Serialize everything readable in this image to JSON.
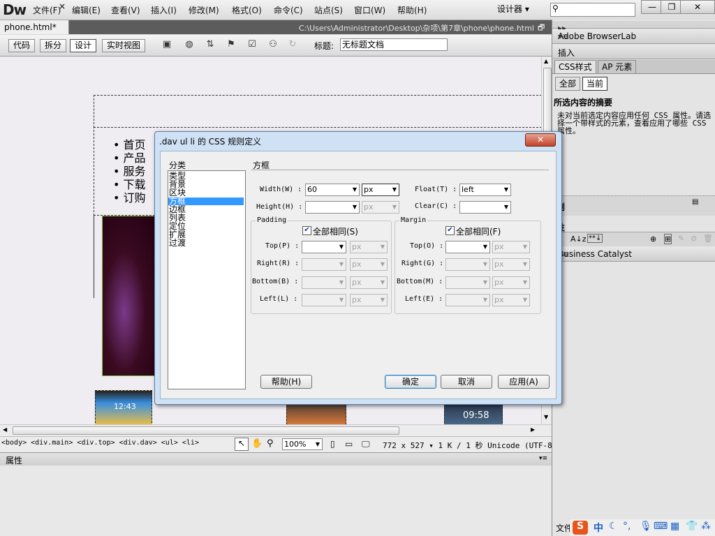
{
  "app": {
    "logo": "Dw",
    "menus": [
      "文件(F)",
      "编辑(E)",
      "查看(V)",
      "插入(I)",
      "修改(M)",
      "格式(O)",
      "命令(C)",
      "站点(S)",
      "窗口(W)",
      "帮助(H)"
    ],
    "workspace": "设计器 ▾",
    "window_buttons": [
      "—",
      "❐",
      "✕"
    ]
  },
  "document": {
    "tab": "phone.html*",
    "tab_close": "×",
    "path": "C:\\Users\\Administrator\\Desktop\\杂项\\第7章\\phone\\phone.html",
    "views": [
      "代码",
      "拆分",
      "设计",
      "实时视图"
    ],
    "active_view": "设计",
    "title_label": "标题:",
    "title_value": "无标题文档"
  },
  "design": {
    "nav_items": [
      "首页",
      "产品",
      "服务",
      "下载",
      "订购"
    ],
    "thumb_time_1": "12:43",
    "thumb_time_2": "09:58"
  },
  "status": {
    "tag_selector": "<body> <div.main> <div.top> <div.dav> <ul> <li>",
    "zoom": "100%",
    "info": "772 x 527 ▾ 1 K / 1 秒 Unicode (UTF-8)"
  },
  "properties": {
    "title": "属性"
  },
  "right_panel": {
    "browserlab": "Adobe BrowserLab",
    "insert": "插入",
    "tabs": [
      "CSS样式",
      "AP 元素"
    ],
    "modes": [
      "全部",
      "当前"
    ],
    "summary_title": "所选内容的摘要",
    "summary_text": "未对当前选定内容应用任何 CSS 属性。请选择一个带样式的元素，查看应用了哪些 CSS 属性。",
    "rules_label": "则",
    "props_label": "性",
    "bc_label": "Business Catalyst",
    "files_label": "文件"
  },
  "dialog": {
    "title": ".dav ul li 的 CSS 规则定义",
    "close": "✕",
    "category_label": "分类",
    "categories": [
      "类型",
      "背景",
      "区块",
      "方框",
      "边框",
      "列表",
      "定位",
      "扩展",
      "过渡"
    ],
    "selected_category": "方框",
    "section_title": "方框",
    "width_label": "Width(W) :",
    "width_value": "60",
    "width_unit": "px",
    "height_label": "Height(H) :",
    "height_unit": "px",
    "float_label": "Float(T) :",
    "float_value": "left",
    "clear_label": "Clear(C) :",
    "padding": {
      "title": "Padding",
      "same_label": "全部相同(S)",
      "rows": [
        {
          "label": "Top(P) :",
          "unit": "px"
        },
        {
          "label": "Right(R) :",
          "unit": "px"
        },
        {
          "label": "Bottom(B) :",
          "unit": "px"
        },
        {
          "label": "Left(L) :",
          "unit": "px"
        }
      ]
    },
    "margin": {
      "title": "Margin",
      "same_label": "全部相同(F)",
      "rows": [
        {
          "label": "Top(O) :",
          "unit": "px"
        },
        {
          "label": "Right(G) :",
          "unit": "px"
        },
        {
          "label": "Bottom(M) :",
          "unit": "px"
        },
        {
          "label": "Left(E) :",
          "unit": "px"
        }
      ]
    },
    "help_button": "帮助(H)",
    "ok_button": "确定",
    "cancel_button": "取消",
    "apply_button": "应用(A)"
  },
  "ime": {
    "brand": "S",
    "lang": "中"
  }
}
